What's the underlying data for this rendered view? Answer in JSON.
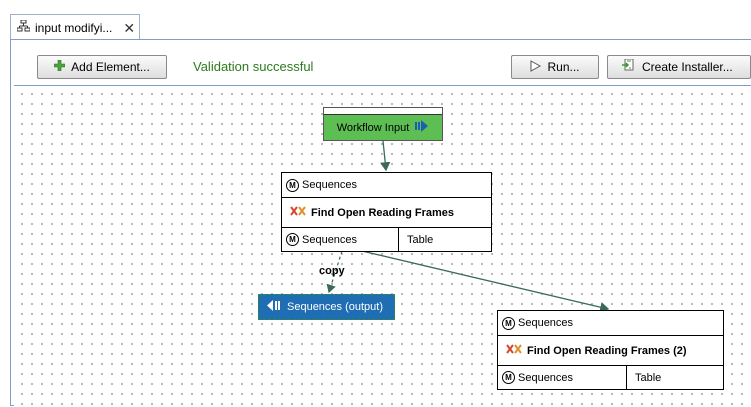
{
  "tab": {
    "label": "input modifyi...",
    "close": "✕"
  },
  "toolbar": {
    "add_element_label": "Add Element...",
    "validation_status": "Validation successful",
    "run_label": "Run...",
    "create_installer_label": "Create Installer..."
  },
  "workflow_input": {
    "label": "Workflow Input"
  },
  "node1": {
    "input_row": "Sequences",
    "title": "Find Open Reading Frames",
    "output_left": "Sequences",
    "output_right": "Table"
  },
  "node2": {
    "input_row": "Sequences",
    "title": "Find Open Reading Frames (2)",
    "output_left": "Sequences",
    "output_right": "Table"
  },
  "output_node": {
    "label": "Sequences (output)"
  },
  "connection_label": "copy",
  "marker_letter": "M",
  "colors": {
    "status_green": "#2c7a1e",
    "workflow_input_green": "#5dbe54",
    "output_blue": "#1f6db3",
    "frame_border": "#7e9ec4"
  }
}
